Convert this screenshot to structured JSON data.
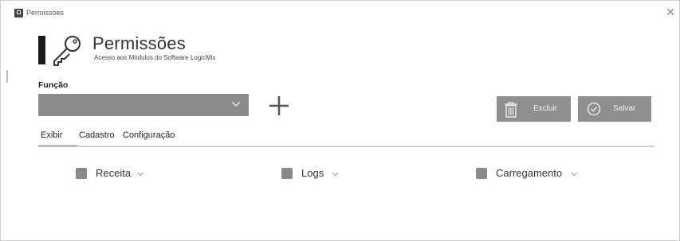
{
  "window": {
    "title": "Permissoes"
  },
  "header": {
    "title": "Permissões",
    "subtitle": "Acesso aos Módulos do Software LogicMix"
  },
  "form": {
    "funcao_label": "Função",
    "funcao_value": ""
  },
  "actions": {
    "excluir_label": "Excluir",
    "salvar_label": "Salvar"
  },
  "tabs": [
    {
      "label": "Exibir",
      "active": true
    },
    {
      "label": "Cadastro",
      "active": false
    },
    {
      "label": "Configuração",
      "active": false
    }
  ],
  "modules": [
    {
      "label": "Receita",
      "checked": false
    },
    {
      "label": "Logs",
      "checked": false
    },
    {
      "label": "Carregamento",
      "checked": false
    }
  ],
  "colors": {
    "button_bg": "#8f8f8f",
    "select_bg": "#8a8a8a",
    "accent_bar": "#1a1a1a"
  }
}
